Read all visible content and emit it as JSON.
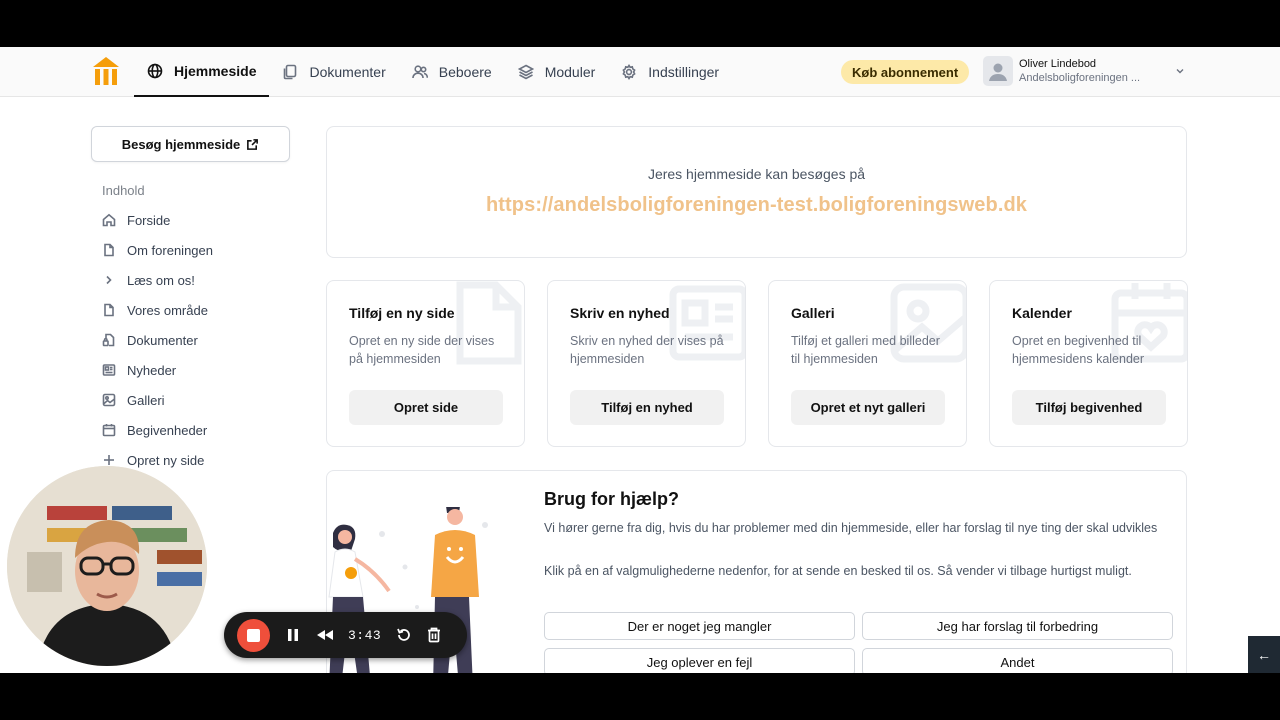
{
  "nav": {
    "items": [
      {
        "label": "Hjemmeside",
        "icon": "globe-icon"
      },
      {
        "label": "Dokumenter",
        "icon": "documents-icon"
      },
      {
        "label": "Beboere",
        "icon": "users-icon"
      },
      {
        "label": "Moduler",
        "icon": "layers-icon"
      },
      {
        "label": "Indstillinger",
        "icon": "gear-icon"
      }
    ],
    "buy_label": "Køb abonnement"
  },
  "user": {
    "name": "Oliver Lindebod",
    "org": "Andelsboligforeningen ..."
  },
  "sidebar": {
    "visit_label": "Besøg hjemmeside",
    "heading": "Indhold",
    "items": [
      {
        "label": "Forside",
        "icon": "home-icon"
      },
      {
        "label": "Om foreningen",
        "icon": "file-icon"
      },
      {
        "label": "Læs om os!",
        "icon": "chevron-right-icon"
      },
      {
        "label": "Vores område",
        "icon": "file-icon"
      },
      {
        "label": "Dokumenter",
        "icon": "file-lock-icon"
      },
      {
        "label": "Nyheder",
        "icon": "newspaper-icon"
      },
      {
        "label": "Galleri",
        "icon": "gallery-icon"
      },
      {
        "label": "Begivenheder",
        "icon": "calendar-icon"
      },
      {
        "label": "Opret ny side",
        "icon": "plus-icon"
      }
    ]
  },
  "main": {
    "url_label": "Jeres hjemmeside kan besøges på",
    "url": "https://andelsboligforeningen-test.boligforeningsweb.dk",
    "cards": [
      {
        "title": "Tilføj en ny side",
        "desc": "Opret en ny side der vises på hjemmesiden",
        "button": "Opret side"
      },
      {
        "title": "Skriv en nyhed",
        "desc": "Skriv en nyhed der vises på hjemmesiden",
        "button": "Tilføj en nyhed"
      },
      {
        "title": "Galleri",
        "desc": "Tilføj et galleri med billeder til hjemmesiden",
        "button": "Opret et nyt galleri"
      },
      {
        "title": "Kalender",
        "desc": "Opret en begivenhed til hjemmesidens kalender",
        "button": "Tilføj begivenhed"
      }
    ],
    "help": {
      "title": "Brug for hjælp?",
      "p1": "Vi hører gerne fra dig, hvis du har problemer med din hjemmeside, eller har forslag til nye ting der skal udvikles",
      "p2": "Klik på en af valgmulighederne nedenfor, for at sende en besked til os. Så vender vi tilbage hurtigst muligt.",
      "buttons": [
        "Der er noget jeg mangler",
        "Jeg har forslag til forbedring",
        "Jeg oplever en fejl",
        "Andet"
      ]
    }
  },
  "recorder": {
    "time": "3:43"
  },
  "side_toggle_label": "←",
  "colors": {
    "accent": "#f0c28a",
    "buy_badge": "#fde9a8",
    "record": "#ef4f3b",
    "logo": "#f59e0b"
  }
}
